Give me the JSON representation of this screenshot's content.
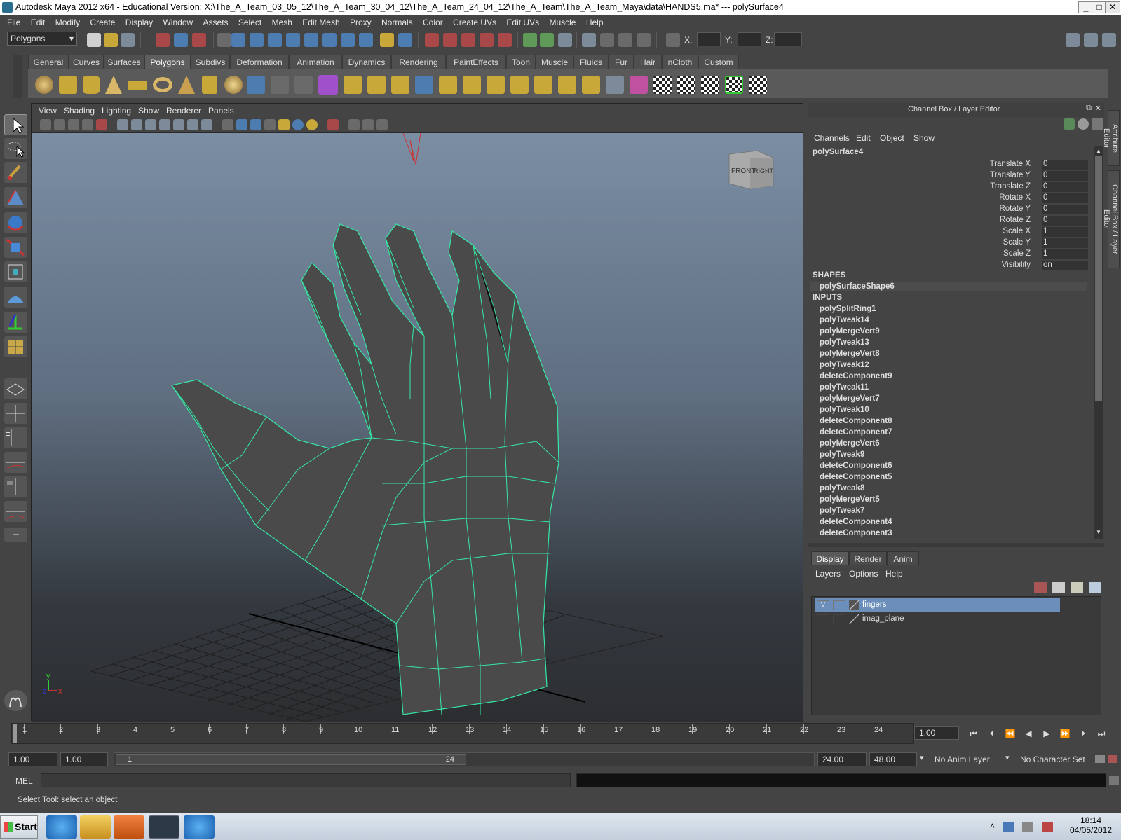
{
  "window": {
    "title": "Autodesk Maya 2012 x64 - Educational Version: X:\\The_A_Team_03_05_12\\The_A_Team_30_04_12\\The_A_Team_24_04_12\\The_A_Team\\The_A_Team_Maya\\data\\HANDS5.ma*   ---   polySurface4",
    "minimize": "_",
    "maximize": "□",
    "close": "✕"
  },
  "menubar": [
    "File",
    "Edit",
    "Modify",
    "Create",
    "Display",
    "Window",
    "Assets",
    "Select",
    "Mesh",
    "Edit Mesh",
    "Proxy",
    "Normals",
    "Color",
    "Create UVs",
    "Edit UVs",
    "Muscle",
    "Help"
  ],
  "toolbar": {
    "mode": "Polygons",
    "x_label": "X:",
    "y_label": "Y:",
    "z_label": "Z:"
  },
  "shelf_tabs": [
    "General",
    "Curves",
    "Surfaces",
    "Polygons",
    "Subdivs",
    "Deformation",
    "Animation",
    "Dynamics",
    "Rendering",
    "PaintEffects",
    "Toon",
    "Muscle",
    "Fluids",
    "Fur",
    "Hair",
    "nCloth",
    "Custom"
  ],
  "shelf_active": "Polygons",
  "viewport": {
    "menus": [
      "View",
      "Shading",
      "Lighting",
      "Show",
      "Renderer",
      "Panels"
    ],
    "viewcube_front": "FRONT",
    "viewcube_right": "RIGHT",
    "axis_y": "y",
    "axis_x": "x",
    "axis_z": "z"
  },
  "channel_box": {
    "header": "Channel Box / Layer Editor",
    "menus": [
      "Channels",
      "Edit",
      "Object",
      "Show"
    ],
    "object": "polySurface4",
    "attributes": [
      {
        "label": "Translate X",
        "value": "0"
      },
      {
        "label": "Translate Y",
        "value": "0"
      },
      {
        "label": "Translate Z",
        "value": "0"
      },
      {
        "label": "Rotate X",
        "value": "0"
      },
      {
        "label": "Rotate Y",
        "value": "0"
      },
      {
        "label": "Rotate Z",
        "value": "0"
      },
      {
        "label": "Scale X",
        "value": "1"
      },
      {
        "label": "Scale Y",
        "value": "1"
      },
      {
        "label": "Scale Z",
        "value": "1"
      },
      {
        "label": "Visibility",
        "value": "on"
      }
    ],
    "shapes_label": "SHAPES",
    "shapes": [
      "polySurfaceShape6"
    ],
    "inputs_label": "INPUTS",
    "inputs": [
      "polySplitRing1",
      "polyTweak14",
      "polyMergeVert9",
      "polyTweak13",
      "polyMergeVert8",
      "polyTweak12",
      "deleteComponent9",
      "polyTweak11",
      "polyMergeVert7",
      "polyTweak10",
      "deleteComponent8",
      "deleteComponent7",
      "polyMergeVert6",
      "polyTweak9",
      "deleteComponent6",
      "deleteComponent5",
      "polyTweak8",
      "polyMergeVert5",
      "polyTweak7",
      "deleteComponent4",
      "deleteComponent3"
    ]
  },
  "layer_editor": {
    "tabs": [
      "Display",
      "Render",
      "Anim"
    ],
    "active_tab": "Display",
    "menus": [
      "Layers",
      "Options",
      "Help"
    ],
    "layers": [
      {
        "name": "fingers",
        "visible": "V",
        "selected": true
      },
      {
        "name": "imag_plane",
        "visible": "",
        "selected": false
      }
    ]
  },
  "side_tabs": [
    "Attribute Editor",
    "Channel Box / Layer Editor"
  ],
  "timeline": {
    "ticks": [
      "1",
      "2",
      "3",
      "4",
      "5",
      "6",
      "7",
      "8",
      "9",
      "10",
      "11",
      "12",
      "13",
      "14",
      "15",
      "16",
      "17",
      "18",
      "19",
      "20",
      "21",
      "22",
      "23",
      "24"
    ],
    "current_frame": "1.00"
  },
  "range": {
    "start": "1.00",
    "playback_start": "1.00",
    "slider_start": "1",
    "slider_end": "24",
    "playback_end": "24.00",
    "end": "48.00",
    "anim_layer": "No Anim Layer",
    "character_set": "No Character Set"
  },
  "mel": {
    "label": "MEL",
    "command": ""
  },
  "status": "Select Tool: select an object",
  "taskbar": {
    "start": "Start",
    "time": "18:14",
    "date": "04/05/2012"
  },
  "colors": {
    "wireframe": "#35e8a6",
    "selected_layer": "#6b8fba"
  }
}
